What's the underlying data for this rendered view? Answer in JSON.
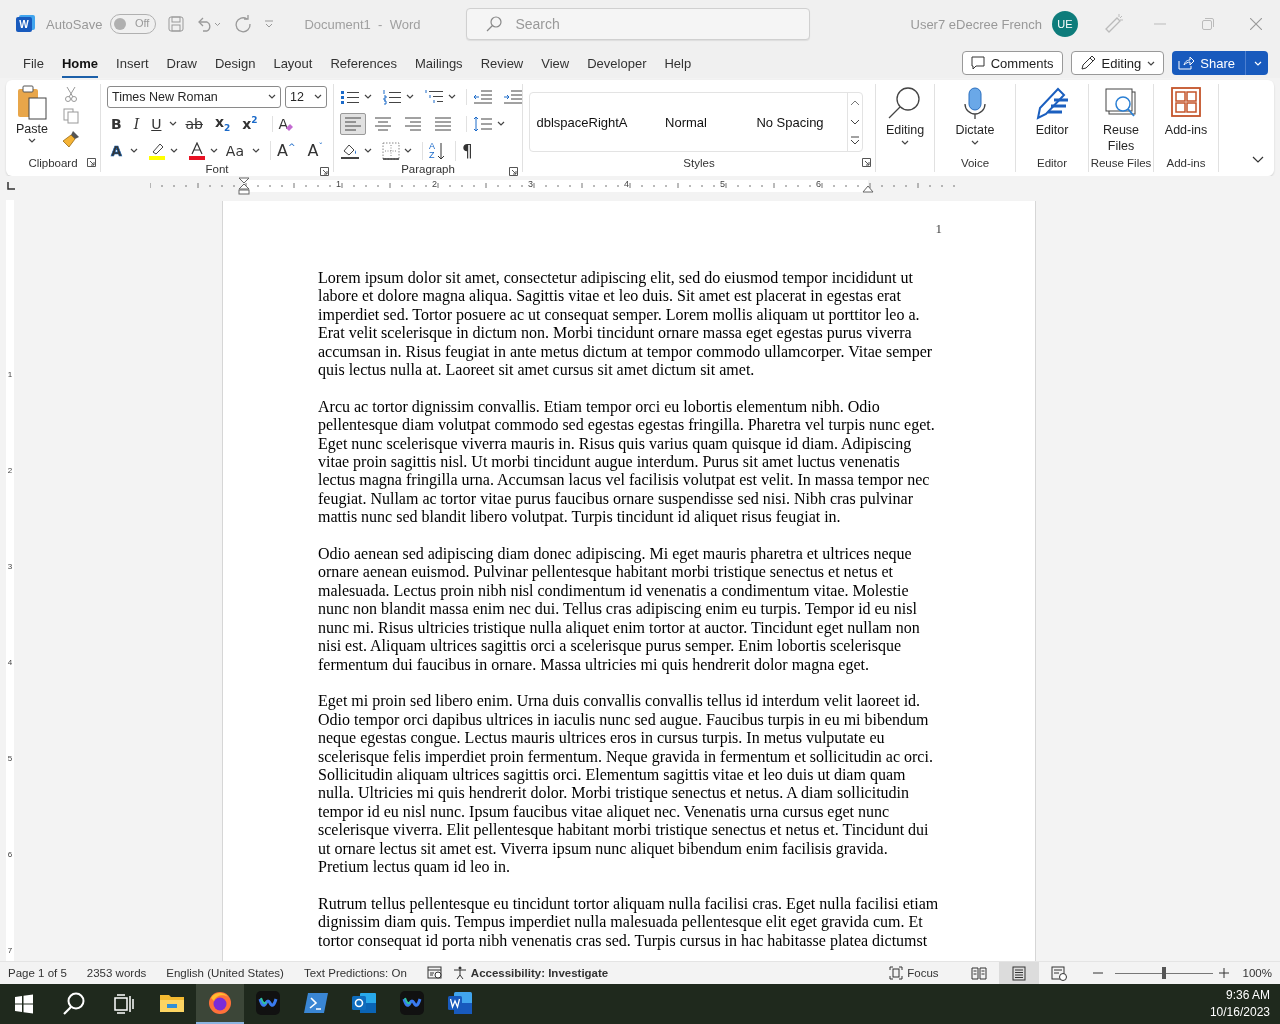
{
  "title_bar": {
    "logo": "W",
    "autosave_label": "AutoSave",
    "autosave_toggle": {
      "label": "Off",
      "on": false
    },
    "document_title": "Document1  -  Word",
    "search": {
      "placeholder": "Search"
    },
    "user_name": "User7 eDecree French",
    "avatar_initials": "UE"
  },
  "menu_tabs": [
    {
      "label": "File",
      "selected": false
    },
    {
      "label": "Home",
      "selected": true
    },
    {
      "label": "Insert",
      "selected": false
    },
    {
      "label": "Draw",
      "selected": false
    },
    {
      "label": "Design",
      "selected": false
    },
    {
      "label": "Layout",
      "selected": false
    },
    {
      "label": "References",
      "selected": false
    },
    {
      "label": "Mailings",
      "selected": false
    },
    {
      "label": "Review",
      "selected": false
    },
    {
      "label": "View",
      "selected": false
    },
    {
      "label": "Developer",
      "selected": false
    },
    {
      "label": "Help",
      "selected": false
    }
  ],
  "header_buttons": {
    "comments": "Comments",
    "editing": "Editing",
    "share": "Share"
  },
  "ribbon": {
    "clipboard": {
      "paste": "Paste",
      "label": "Clipboard"
    },
    "font": {
      "font_name": "Times New Roman",
      "font_size": "12",
      "clear_formatting_button": "A",
      "text_effects_button": "A",
      "format_buttons": [
        "B",
        "I",
        "U",
        "ab",
        "x$_{2}$",
        "x$^{2}$"
      ],
      "case_button": "Aa",
      "grow_button": "A$^{^}$",
      "shrink_button": "A$^{ˇ}$",
      "label": "Font"
    },
    "paragraph": {
      "label": "Paragraph",
      "sort_button": [
        "A",
        "Z"
      ],
      "align": [
        {
          "kind": "left",
          "selected": true
        },
        {
          "kind": "center",
          "selected": false
        },
        {
          "kind": "right",
          "selected": false
        },
        {
          "kind": "justify",
          "selected": false
        }
      ],
      "pilcrow": "¶"
    },
    "styles": {
      "items": [
        {
          "label": "dblspaceRightA",
          "selected": false
        },
        {
          "label": "Normal",
          "selected": false
        },
        {
          "label": "No Spacing",
          "selected": false
        }
      ],
      "label": "Styles"
    },
    "editing": {
      "button": "Editing"
    },
    "voice": {
      "button": "Dictate",
      "label": "Voice"
    },
    "editor": {
      "button": "Editor",
      "label": "Editor"
    },
    "reuse_files": {
      "button": "Reuse Files",
      "label": "Reuse Files"
    },
    "add_ins": {
      "button": "Add-ins",
      "label": "Add-ins"
    }
  },
  "ruler": {
    "numbers": [
      "1",
      "2",
      "3",
      "4",
      "5",
      "6"
    ]
  },
  "vertical_ruler": {
    "numbers": [
      "1",
      "2",
      "3",
      "4",
      "5",
      "6",
      "7"
    ]
  },
  "document": {
    "page_number": "1",
    "paragraphs": [
      "Lorem ipsum dolor sit amet, consectetur adipiscing elit, sed do eiusmod tempor incididunt ut labore et dolore magna aliqua. Sagittis vitae et leo duis. Sit amet est placerat in egestas erat imperdiet sed. Tortor posuere ac ut consequat semper. Lorem mollis aliquam ut porttitor leo a. Erat velit scelerisque in dictum non. Morbi tincidunt ornare massa eget egestas purus viverra accumsan in. Risus feugiat in ante metus dictum at tempor commodo ullamcorper. Vitae semper quis lectus nulla at. Laoreet sit amet cursus sit amet dictum sit amet.",
      "Arcu ac tortor dignissim convallis. Etiam tempor orci eu lobortis elementum nibh. Odio pellentesque diam volutpat commodo sed egestas egestas fringilla. Pharetra vel turpis nunc eget. Eget nunc scelerisque viverra mauris in. Risus quis varius quam quisque id diam. Adipiscing vitae proin sagittis nisl. Ut morbi tincidunt augue interdum. Purus sit amet luctus venenatis lectus magna fringilla urna. Accumsan lacus vel facilisis volutpat est velit. In massa tempor nec feugiat. Nullam ac tortor vitae purus faucibus ornare suspendisse sed nisi. Nibh cras pulvinar mattis nunc sed blandit libero volutpat. Turpis tincidunt id aliquet risus feugiat in.",
      "Odio aenean sed adipiscing diam donec adipiscing. Mi eget mauris pharetra et ultrices neque ornare aenean euismod. Pulvinar pellentesque habitant morbi tristique senectus et netus et malesuada. Lectus proin nibh nisl condimentum id venenatis a condimentum vitae. Molestie nunc non blandit massa enim nec dui. Tellus cras adipiscing enim eu turpis. Tempor id eu nisl nunc mi. Risus ultricies tristique nulla aliquet enim tortor at auctor. Tincidunt eget nullam non nisi est. Aliquam ultrices sagittis orci a scelerisque purus semper. Enim lobortis scelerisque fermentum dui faucibus in ornare. Massa ultricies mi quis hendrerit dolor magna eget.",
      "Eget mi proin sed libero enim. Urna duis convallis convallis tellus id interdum velit laoreet id. Odio tempor orci dapibus ultrices in iaculis nunc sed augue. Faucibus turpis in eu mi bibendum neque egestas congue. Lectus mauris ultrices eros in cursus turpis. In metus vulputate eu scelerisque felis imperdiet proin fermentum. Neque gravida in fermentum et sollicitudin ac orci. Sollicitudin aliquam ultrices sagittis orci. Elementum sagittis vitae et leo duis ut diam quam nulla. Ultricies mi quis hendrerit dolor. Morbi tristique senectus et netus. A diam sollicitudin tempor id eu nisl nunc. Ipsum faucibus vitae aliquet nec. Venenatis urna cursus eget nunc scelerisque viverra. Elit pellentesque habitant morbi tristique senectus et netus et. Tincidunt dui ut ornare lectus sit amet est. Viverra ipsum nunc aliquet bibendum enim facilisis gravida. Pretium lectus quam id leo in.",
      "Rutrum tellus pellentesque eu tincidunt tortor aliquam nulla facilisi cras. Eget nulla facilisi etiam dignissim diam quis. Tempus imperdiet nulla malesuada pellentesque elit eget gravida cum. Et tortor consequat id porta nibh venenatis cras sed. Turpis cursus in hac habitasse platea dictumst"
    ]
  },
  "status_bar": {
    "items": [
      "Page 1 of 5",
      "2353 words",
      "English (United States)",
      "Text Predictions: On"
    ],
    "accessibility": "Accessibility: Investigate",
    "focus": "Focus",
    "views": [
      {
        "kind": "read",
        "selected": false
      },
      {
        "kind": "print",
        "selected": true
      },
      {
        "kind": "web",
        "selected": false
      }
    ],
    "zoom": {
      "level": 0.5,
      "label": "100%"
    }
  },
  "taskbar": {
    "apps": [
      {
        "kind": "folder",
        "selected": false
      },
      {
        "kind": "browser",
        "selected": true
      },
      {
        "kind": "meeting",
        "selected": false
      },
      {
        "kind": "terminal",
        "selected": false
      },
      {
        "kind": "mail",
        "selected": false
      },
      {
        "kind": "meeting",
        "selected": false
      },
      {
        "kind": "word",
        "selected": false
      }
    ],
    "time": "9:36 AM",
    "date": "10/16/2023"
  }
}
